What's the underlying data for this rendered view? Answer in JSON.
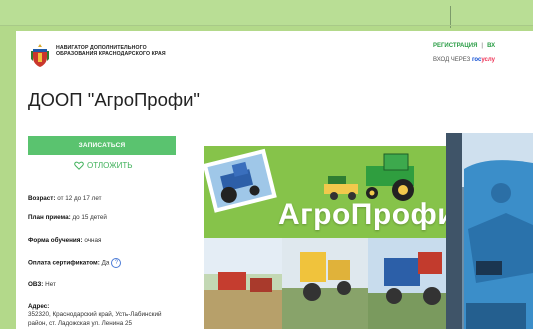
{
  "header": {
    "brand_text": "НАВИГАТОР ДОПОЛНИТЕЛЬНОГО ОБРАЗОВАНИЯ КРАСНОДАРСКОГО КРАЯ",
    "register_link": "РЕГИСТРАЦИЯ",
    "separator": "|",
    "login_cut": "ВХ",
    "gosuslugi_prefix": "ВХОД ЧЕРЕЗ",
    "gosuslugi_part1": "гос",
    "gosuslugi_part2": "услу"
  },
  "program": {
    "title": "ДООП \"АгроПрофи\"",
    "enroll_button": "ЗАПИСАТЬСЯ",
    "postpone_label": "ОТЛОЖИТЬ"
  },
  "details": {
    "age_label": "Возраст:",
    "age_value": "от 12 до 17 лет",
    "plan_label": "План приема:",
    "plan_value": "до 15 детей",
    "form_label": "Форма обучения:",
    "form_value": "очная",
    "payment_label": "Оплата сертификатом:",
    "payment_value": "Да",
    "help_icon": "?",
    "ovz_label": "ОВЗ:",
    "ovz_value": "Нет",
    "address_label": "Адрес:",
    "address_line1": "352320, Краснодарский край, Усть-Лабинский",
    "address_line2": "район, ст. Ладожская ул. Ленина 25"
  },
  "banner": {
    "name": "АгроПрофи"
  },
  "colors": {
    "page_bg": "#b3d98a",
    "accent_green": "#5ac36f",
    "link_green": "#2a9d46",
    "banner_green": "#86c34a",
    "gos_blue": "#0d4cd3",
    "gos_red": "#ee2f53"
  },
  "icons": {
    "crest": "krasnodar-crest-icon",
    "heart": "heart-icon",
    "help": "question-circle-icon"
  }
}
